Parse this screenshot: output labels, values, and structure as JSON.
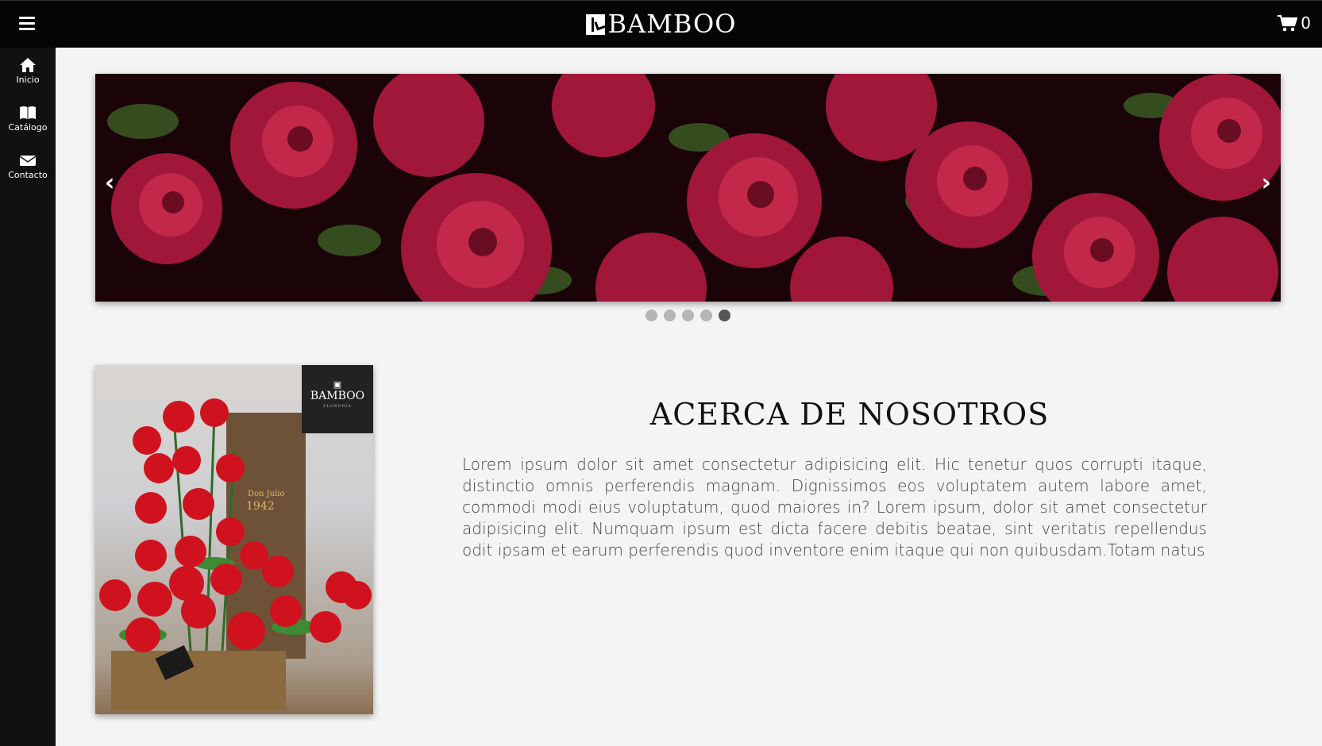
{
  "header": {
    "brand": "BAMBOO",
    "cart_count": "0"
  },
  "sidebar": {
    "items": [
      {
        "label": "Inicio",
        "icon": "home-icon"
      },
      {
        "label": "Catálogo",
        "icon": "book-icon"
      },
      {
        "label": "Contacto",
        "icon": "envelope-icon"
      }
    ]
  },
  "carousel": {
    "prev_label": "‹",
    "next_label": "›",
    "slide_count": 5,
    "active_slide": 5
  },
  "product": {
    "tag_brand": "BAMBOO",
    "tag_sub": "FLORERÍA",
    "bottle_label": "Don Julio 1942"
  },
  "about": {
    "title": "ACERCA DE NOSOTROS",
    "text": "Lorem ipsum dolor sit amet consectetur adipisicing elit. Hic tenetur quos corrupti itaque, distinctio omnis perferendis magnam. Dignissimos eos voluptatem autem labore amet, commodi modi eius voluptatum, quod maiores in? Lorem ipsum, dolor sit amet consectetur adipisicing elit. Numquam ipsum est dicta facere debitis beatae, sint veritatis repellendus odit ipsam et earum perferendis quod inventore enim itaque qui non quibusdam.Totam natus"
  },
  "colors": {
    "header_bg": "#050505",
    "sidebar_bg": "#111111",
    "page_bg": "#f4f4f4",
    "rose": "#c0143c"
  }
}
